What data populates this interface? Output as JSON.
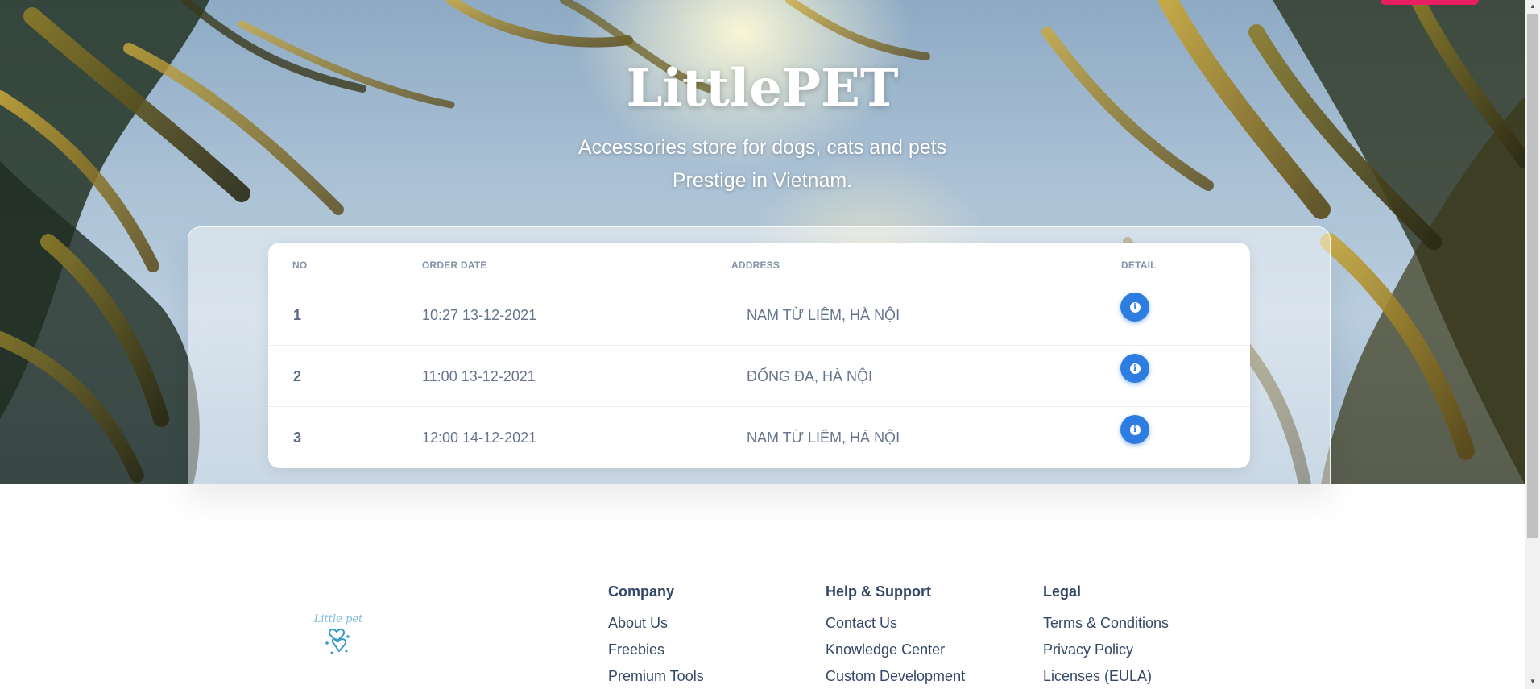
{
  "hero": {
    "title": "LittlePET",
    "subtitle_line1": "Accessories store for dogs, cats and pets",
    "subtitle_line2": "Prestige in Vietnam."
  },
  "orders_table": {
    "headers": {
      "no": "NO",
      "order_date": "ORDER DATE",
      "address": "ADDRESS",
      "detail": "DETAIL"
    },
    "rows": [
      {
        "no": "1",
        "order_date": "10:27 13-12-2021",
        "address": "NAM TỪ LIÊM, HÀ NỘI"
      },
      {
        "no": "2",
        "order_date": "11:00 13-12-2021",
        "address": "ĐỐNG ĐA, HÀ NỘI"
      },
      {
        "no": "3",
        "order_date": "12:00 14-12-2021",
        "address": "NAM TỪ LIÊM, HÀ NỘI"
      }
    ],
    "detail_icon": "info-icon"
  },
  "footer": {
    "logo_text": "Little pet",
    "company": {
      "title": "Company",
      "links": [
        "About Us",
        "Freebies",
        "Premium Tools"
      ]
    },
    "help": {
      "title": "Help & Support",
      "links": [
        "Contact Us",
        "Knowledge Center",
        "Custom Development"
      ]
    },
    "legal": {
      "title": "Legal",
      "links": [
        "Terms & Conditions",
        "Privacy Policy",
        "Licenses (EULA)"
      ]
    }
  },
  "colors": {
    "accent_blue": "#2d7de0",
    "pink_button": "#e91e63",
    "heading_text": "#344767",
    "muted_text": "#67748e"
  }
}
